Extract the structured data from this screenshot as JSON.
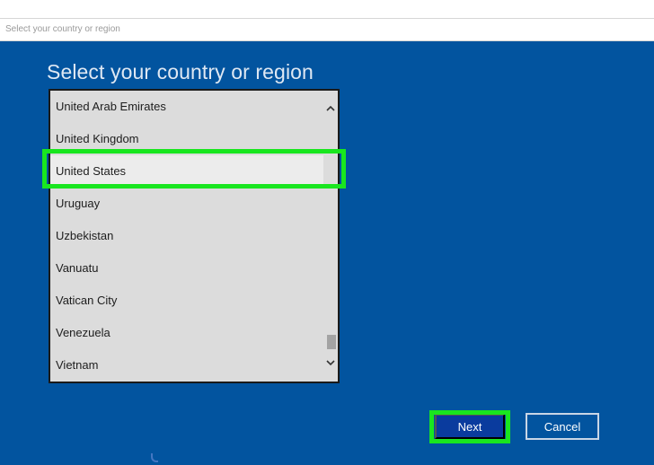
{
  "window": {
    "title": "Select your country or region"
  },
  "page": {
    "heading": "Select your country or region"
  },
  "country_list": {
    "items": [
      {
        "label": "United Arab Emirates",
        "selected": false
      },
      {
        "label": "United Kingdom",
        "selected": false
      },
      {
        "label": "United States",
        "selected": true
      },
      {
        "label": "Uruguay",
        "selected": false
      },
      {
        "label": "Uzbekistan",
        "selected": false
      },
      {
        "label": "Vanuatu",
        "selected": false
      },
      {
        "label": "Vatican City",
        "selected": false
      },
      {
        "label": "Venezuela",
        "selected": false
      },
      {
        "label": "Vietnam",
        "selected": false
      }
    ]
  },
  "buttons": {
    "next_label": "Next",
    "cancel_label": "Cancel"
  },
  "icons": {
    "scroll_up": "chevron-up-icon",
    "scroll_down": "chevron-down-icon"
  },
  "colors": {
    "background": "#02549f",
    "highlight": "#19e61f",
    "next_button": "#0a3b9e",
    "list_background": "#dcdcdc"
  }
}
